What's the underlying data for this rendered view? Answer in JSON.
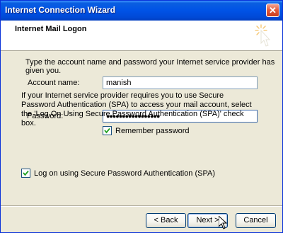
{
  "window": {
    "title": "Internet Connection Wizard",
    "close_glyph": "✕"
  },
  "header": {
    "title": "Internet Mail Logon",
    "icon": "wizard-wand-icon"
  },
  "intro_text": "Type the account name and password your Internet service provider has given you.",
  "account": {
    "label": "Account name:",
    "value": "manish"
  },
  "password": {
    "label": "Password:",
    "value": "●●●●●●●●●●●●●●●●●"
  },
  "remember": {
    "label": "Remember password",
    "checked": true
  },
  "spa_info": "If your Internet service provider requires you to use Secure Password Authentication (SPA) to access your mail account, select the 'Log On Using Secure Password Authentication (SPA)' check box.",
  "spa_checkbox": {
    "label": "Log on using Secure Password Authentication (SPA)",
    "checked": true
  },
  "buttons": {
    "back": "< Back",
    "next": "Next >",
    "cancel": "Cancel"
  },
  "colors": {
    "titlebar": "#0053e6",
    "face": "#ece9d8",
    "input_border": "#7f9db9"
  }
}
